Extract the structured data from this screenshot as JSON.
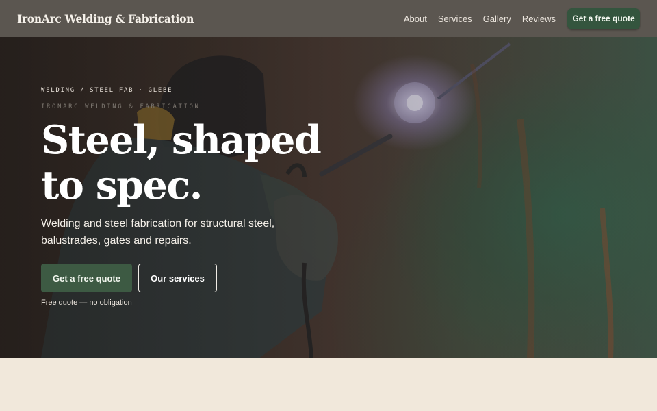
{
  "nav": {
    "brand": "IronArc Welding & Fabrication",
    "links": [
      "About",
      "Services",
      "Gallery",
      "Reviews"
    ],
    "cta": "Get a free quote"
  },
  "hero": {
    "kicker": "WELDING / STEEL FAB · GLEBE",
    "sub_kicker": "IRONARC WELDING & FABRICATION",
    "headline": "Steel, shaped to spec.",
    "lede": "Welding and steel fabrication for structural steel, balustrades, gates and repairs.",
    "primary_cta": "Get a free quote",
    "secondary_cta": "Our services",
    "note": "Free quote — no obligation"
  },
  "colors": {
    "nav_bg": "#5b5650",
    "accent_green": "#3d5a43",
    "page_bg": "#f1e8db"
  }
}
